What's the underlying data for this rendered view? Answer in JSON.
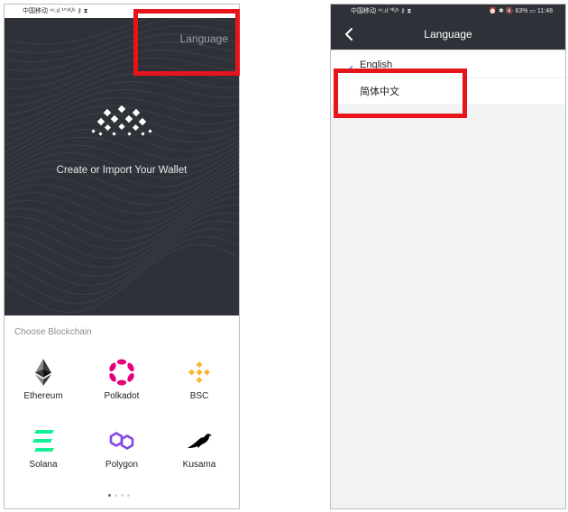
{
  "left_screen": {
    "status_bar": "中国移动 ⁴⁶.ıl ¹⁰⁵ᴷ/ˢ ⚷ ⧗",
    "language_link": "Language",
    "headline": "Create or Import Your Wallet",
    "choose_label": "Choose Blockchain",
    "chains": [
      {
        "label": "Ethereum",
        "icon": "ethereum-icon",
        "color": "#343434"
      },
      {
        "label": "Polkadot",
        "icon": "polkadot-icon",
        "color": "#e6007a"
      },
      {
        "label": "BSC",
        "icon": "bsc-icon",
        "color": "#f3ba2f"
      },
      {
        "label": "Solana",
        "icon": "solana-icon",
        "color": "#14f195"
      },
      {
        "label": "Polygon",
        "icon": "polygon-icon",
        "color": "#8247e5"
      },
      {
        "label": "Kusama",
        "icon": "kusama-icon",
        "color": "#000000"
      }
    ],
    "page_indicator": {
      "total": 4,
      "active": 0
    }
  },
  "right_screen": {
    "status_bar_left": "中国移动 ⁴⁶.ıl ⁰ᴷ/ˢ ⚷ ⧗",
    "status_bar_right": "⏰ ✱ 🔇 63% ▭ 11:48",
    "title": "Language",
    "languages": [
      {
        "label": "English",
        "selected": true
      },
      {
        "label": "简体中文",
        "selected": false
      }
    ]
  },
  "colors": {
    "dark_bg": "#2e3238",
    "highlight": "#e8141c",
    "check": "#4a90e2"
  }
}
